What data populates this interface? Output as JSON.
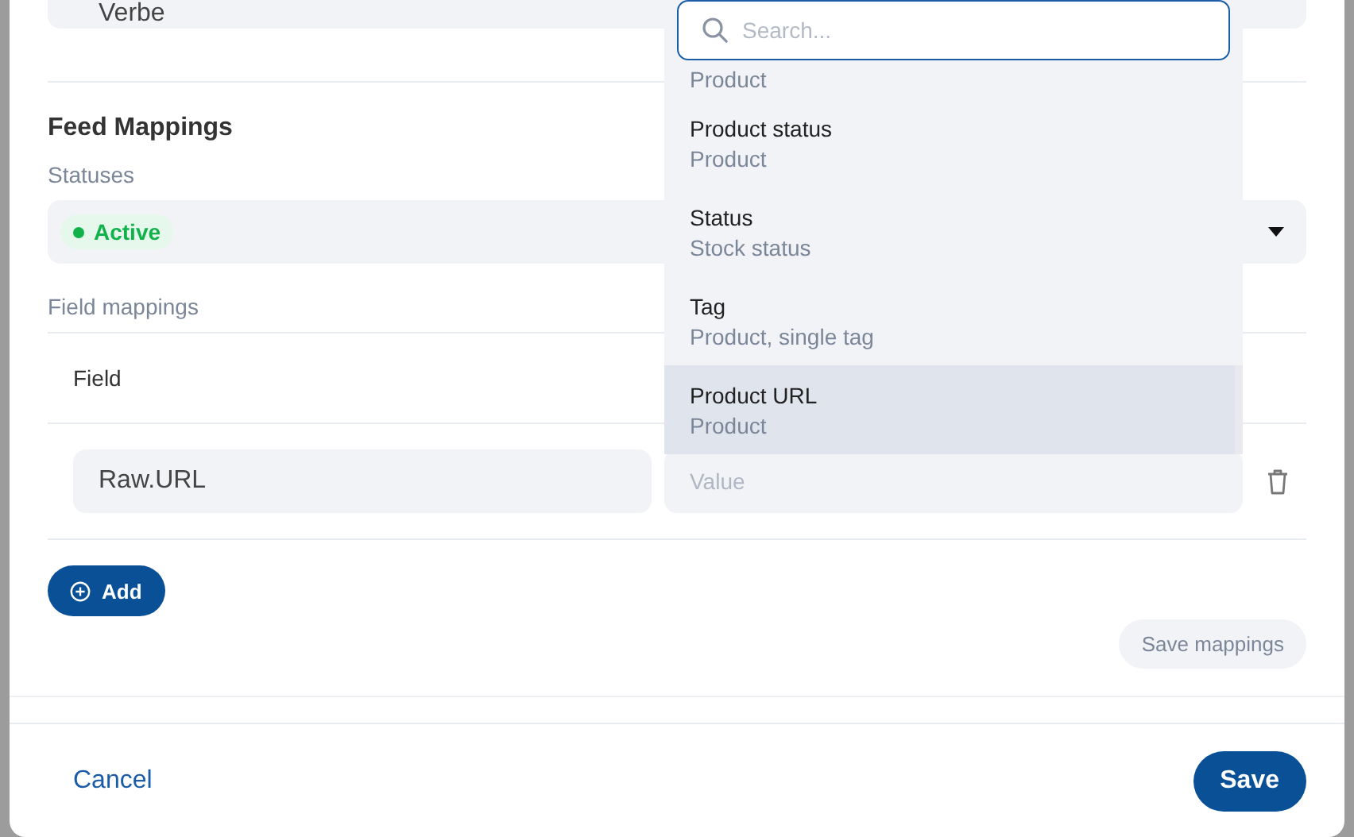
{
  "top_field": {
    "value": "Verbe"
  },
  "section_title": "Feed Mappings",
  "statuses": {
    "label": "Statuses",
    "chips": [
      {
        "label": "Active",
        "color": "#12b24b"
      }
    ]
  },
  "field_mappings": {
    "label": "Field mappings",
    "columns": [
      "Field"
    ],
    "rows": [
      {
        "field": "Raw.URL",
        "value_placeholder": "Value"
      }
    ]
  },
  "add_button": {
    "label": "Add"
  },
  "save_mappings_button": {
    "label": "Save mappings",
    "disabled": true
  },
  "footer": {
    "cancel": "Cancel",
    "save": "Save"
  },
  "dropdown": {
    "search_placeholder": "Search...",
    "options": [
      {
        "detail": "Product",
        "highlighted": false
      },
      {
        "label": "Product status",
        "detail": "Product",
        "highlighted": false
      },
      {
        "label": "Status",
        "detail": "Stock status",
        "highlighted": false
      },
      {
        "label": "Tag",
        "detail": "Product, single tag",
        "highlighted": false
      },
      {
        "label": "Product URL",
        "detail": "Product",
        "highlighted": true
      }
    ]
  }
}
